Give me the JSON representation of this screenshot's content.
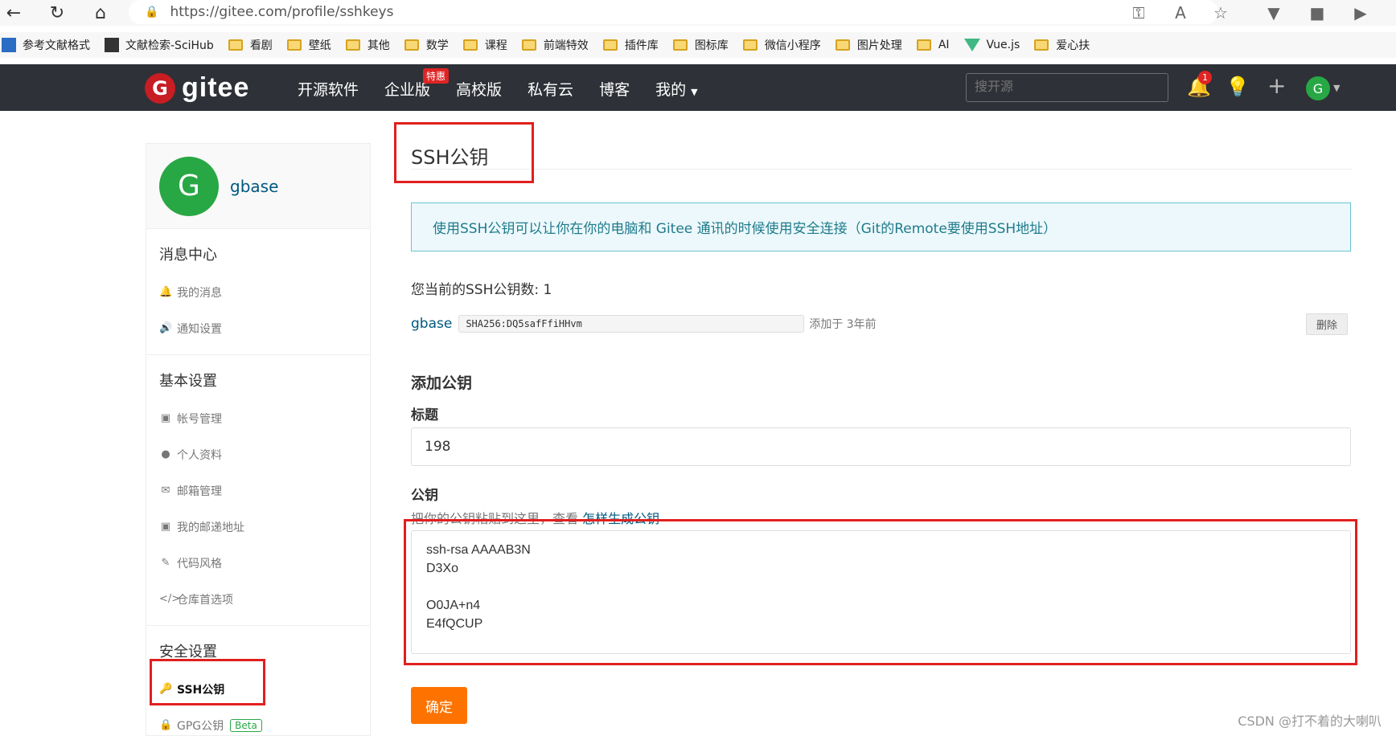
{
  "browser": {
    "url": "https://gitee.com/profile/sshkeys"
  },
  "bookmarks": [
    {
      "label": "参考文献格式",
      "type": "logo"
    },
    {
      "label": "文献检索-SciHub",
      "type": "logo"
    },
    {
      "label": "看剧",
      "type": "folder"
    },
    {
      "label": "壁纸",
      "type": "folder"
    },
    {
      "label": "其他",
      "type": "folder"
    },
    {
      "label": "数学",
      "type": "folder"
    },
    {
      "label": "课程",
      "type": "folder"
    },
    {
      "label": "前端特效",
      "type": "folder"
    },
    {
      "label": "插件库",
      "type": "folder"
    },
    {
      "label": "图标库",
      "type": "folder"
    },
    {
      "label": "微信小程序",
      "type": "folder"
    },
    {
      "label": "图片处理",
      "type": "folder"
    },
    {
      "label": "AI",
      "type": "folder"
    },
    {
      "label": "Vue.js",
      "type": "vue"
    },
    {
      "label": "爱心扶",
      "type": "folder"
    }
  ],
  "header": {
    "logo_letter": "G",
    "logo_text": "gitee",
    "nav": [
      "开源软件",
      "企业版",
      "高校版",
      "私有云",
      "博客",
      "我的"
    ],
    "hot_badge": "特惠",
    "search_placeholder": "搜开源",
    "notification_count": "1",
    "avatar_letter": "G"
  },
  "sidebar": {
    "avatar_letter": "G",
    "username": "gbase",
    "sections": [
      {
        "title": "消息中心",
        "items": [
          {
            "label": "我的消息",
            "icon": "bell-icon",
            "glyph": "🔔"
          },
          {
            "label": "通知设置",
            "icon": "speaker-icon",
            "glyph": "🔊"
          }
        ]
      },
      {
        "title": "基本设置",
        "items": [
          {
            "label": "帐号管理",
            "icon": "id-card-icon",
            "glyph": "▣"
          },
          {
            "label": "个人资料",
            "icon": "user-icon",
            "glyph": "●"
          },
          {
            "label": "邮箱管理",
            "icon": "mail-icon",
            "glyph": "✉"
          },
          {
            "label": "我的邮递地址",
            "icon": "address-card-icon",
            "glyph": "▣"
          },
          {
            "label": "代码风格",
            "icon": "brush-icon",
            "glyph": "✎"
          },
          {
            "label": "仓库首选项",
            "icon": "code-icon",
            "glyph": "</>"
          }
        ]
      },
      {
        "title": "安全设置",
        "items": [
          {
            "label": "SSH公钥",
            "icon": "key-icon",
            "glyph": "🔑",
            "active": true
          },
          {
            "label": "GPG公钥",
            "icon": "lock-icon",
            "glyph": "🔒",
            "badge": "Beta"
          }
        ]
      }
    ]
  },
  "main": {
    "title": "SSH公钥",
    "info": "使用SSH公钥可以让你在你的电脑和 Gitee 通讯的时候使用安全连接（Git的Remote要使用SSH地址）",
    "key_count": "您当前的SSH公钥数: 1",
    "key": {
      "name": "gbase",
      "fingerprint": "SHA256:DQ5safFfiHHvm",
      "added": "添加于 3年前",
      "delete_label": "删除"
    },
    "add_title": "添加公钥",
    "title_label": "标题",
    "title_value": "198",
    "pubkey_label": "公钥",
    "hint_prefix": "把你的公钥粘贴到这里，查看 ",
    "hint_link": "怎样生成公钥",
    "pubkey_lines": [
      "ssh-rsa AAAAB3N",
      "D3Xo",
      "",
      "O0JA+n4",
      "E4fQCUP"
    ],
    "submit_label": "确定"
  },
  "watermark": "CSDN @打不着的大喇叭",
  "colors": {
    "header_bg": "#2e3137",
    "accent_orange": "#fe7300",
    "link_blue": "#005980",
    "info_bg": "#ecf8fb",
    "annotation_red": "#e0201f",
    "avatar_green": "#28a745"
  }
}
